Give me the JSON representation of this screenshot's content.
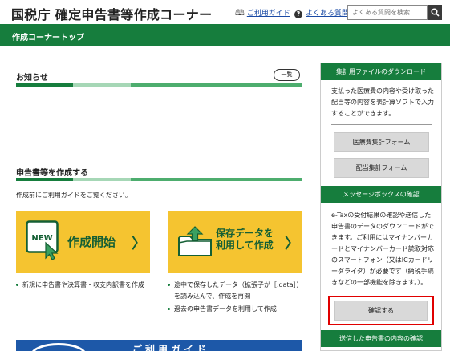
{
  "header": {
    "title": "国税庁 確定申告書等作成コーナー",
    "guide_link": "ご利用ガイド",
    "faq_link": "よくある質問",
    "search_placeholder": "よくある質問を検索"
  },
  "greenbar": {
    "title": "作成コーナートップ"
  },
  "news": {
    "heading": "お知らせ",
    "list_button": "一覧"
  },
  "create": {
    "heading": "申告書等を作成する",
    "intro": "作成前にご利用ガイドをご覧ください。",
    "start_card": {
      "badge": "NEW",
      "label": "作成開始",
      "arrow": "〉"
    },
    "saved_card": {
      "label": "保存データを利用して作成",
      "arrow": "〉"
    },
    "start_bullets": [
      "新規に申告書や決算書・収支内訳書を作成"
    ],
    "saved_bullets": [
      "途中で保存したデータ（拡張子が［.data］）を読み込んで、作成を再開",
      "過去の申告書データを利用して作成"
    ],
    "guide_banner": "ご利用ガイド"
  },
  "sidebar": {
    "download": {
      "heading": "集計用ファイルのダウンロード",
      "text": "支払った医療費の内容や受け取った配当等の内容を表計算ソフトで入力することができます。",
      "buttons": [
        "医療費集計フォーム",
        "配当集計フォーム"
      ]
    },
    "messagebox": {
      "heading": "メッセージボックスの確認",
      "text": "e-Taxの受付結果の確認や送信した申告書のデータのダウンロードができます。ご利用にはマイナンバーカードとマイナンバーカード読取対応のスマートフォン（又はICカードリーダライタ）が必要です（納税手続きなどの一部機能を除きます。）。",
      "confirm_button": "確認する"
    },
    "sent": {
      "heading": "送信した申告書の内容の確認"
    }
  },
  "colors": {
    "brand_green": "#167d3d",
    "card_yellow": "#f5c430",
    "highlight_red": "#e00000",
    "guide_blue": "#1d58a8"
  }
}
